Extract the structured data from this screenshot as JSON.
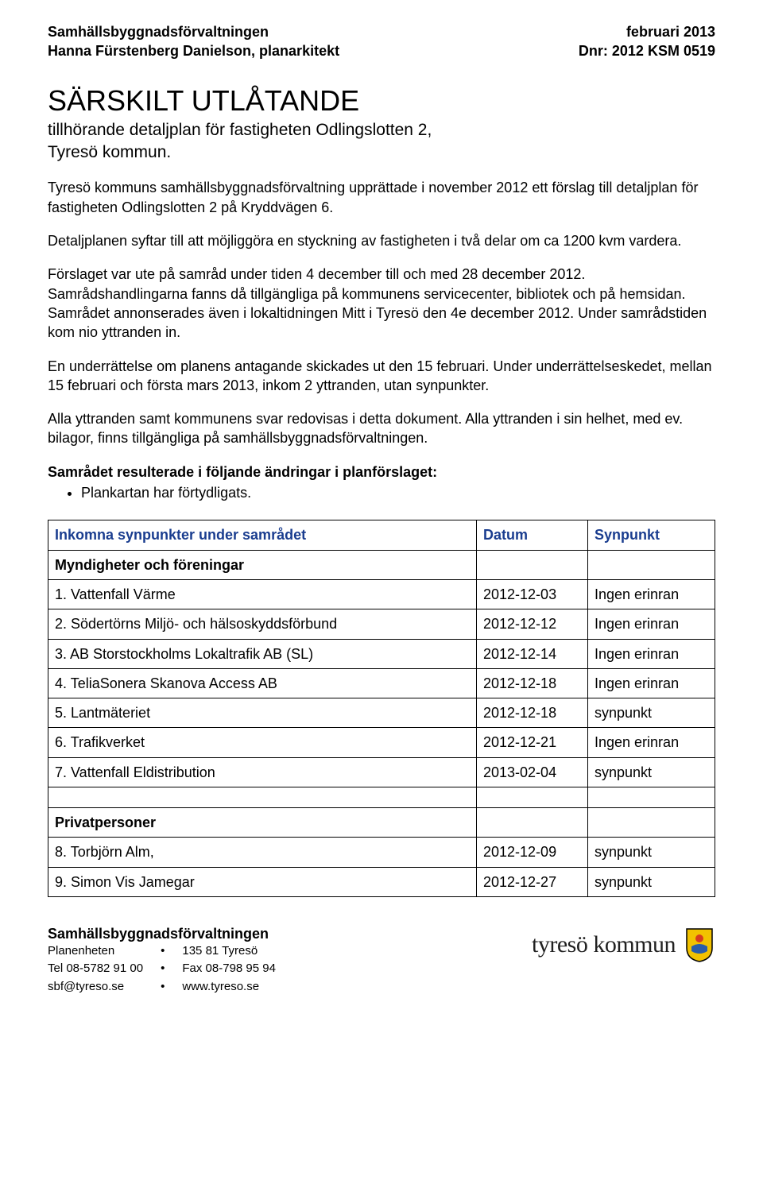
{
  "header": {
    "left1": "Samhällsbyggnadsförvaltningen",
    "left2": "Hanna Fürstenberg Danielson, planarkitekt",
    "right1": "februari 2013",
    "right2": "Dnr: 2012 KSM 0519"
  },
  "title": "SÄRSKILT UTLÅTANDE",
  "subtitle1": "tillhörande detaljplan för fastigheten Odlingslotten 2,",
  "subtitle2": "Tyresö kommun.",
  "para1": "Tyresö kommuns samhällsbyggnadsförvaltning upprättade i november 2012 ett förslag till detaljplan för fastigheten Odlingslotten 2 på Kryddvägen 6.",
  "para2": "Detaljplanen syftar till att möjliggöra en styckning av fastigheten i två delar om ca 1200 kvm vardera.",
  "para3": "Förslaget var ute på samråd under tiden 4 december till och med 28 december 2012. Samrådshandlingarna fanns då tillgängliga på kommunens servicecenter, bibliotek och på hemsidan. Samrådet annonserades även i lokaltidningen Mitt i Tyresö den 4e december 2012. Under samrådstiden kom nio yttranden in.",
  "para4": "En underrättelse om planens antagande skickades ut den 15 februari. Under underrättelseskedet, mellan 15 februari och första mars 2013, inkom 2 yttranden, utan synpunkter.",
  "para5": "Alla yttranden samt kommunens svar redovisas i detta dokument. Alla yttranden i sin helhet, med ev. bilagor, finns tillgängliga på samhällsbyggnadsförvaltningen.",
  "changes_heading": "Samrådet resulterade i följande ändringar i planförslaget:",
  "changes_bullet": "Plankartan har förtydligats.",
  "table": {
    "head": [
      "Inkomna synpunkter under samrådet",
      "Datum",
      "Synpunkt"
    ],
    "section1": "Myndigheter och föreningar",
    "rows1": [
      [
        "1. Vattenfall Värme",
        "2012-12-03",
        "Ingen erinran"
      ],
      [
        "2. Södertörns Miljö- och hälsoskyddsförbund",
        "2012-12-12",
        "Ingen erinran"
      ],
      [
        "3. AB Storstockholms Lokaltrafik AB (SL)",
        "2012-12-14",
        "Ingen erinran"
      ],
      [
        "4. TeliaSonera Skanova Access AB",
        "2012-12-18",
        "Ingen erinran"
      ],
      [
        "5. Lantmäteriet",
        "2012-12-18",
        "synpunkt"
      ],
      [
        "6. Trafikverket",
        "2012-12-21",
        "Ingen erinran"
      ],
      [
        "7. Vattenfall Eldistribution",
        "2013-02-04",
        "synpunkt"
      ]
    ],
    "section2": "Privatpersoner",
    "rows2": [
      [
        "8. Torbjörn Alm,",
        "2012-12-09",
        "synpunkt"
      ],
      [
        "9. Simon Vis Jamegar",
        "2012-12-27",
        "synpunkt"
      ]
    ]
  },
  "footer": {
    "org": "Samhällsbyggnadsförvaltningen",
    "r1c1": "Planenheten",
    "r1c2": "135 81 Tyresö",
    "r2c1": "Tel 08-5782 91 00",
    "r2c2": "Fax 08-798 95 94",
    "r3c1": "sbf@tyreso.se",
    "r3c2": "www.tyreso.se",
    "logo_text": "tyresö kommun"
  }
}
